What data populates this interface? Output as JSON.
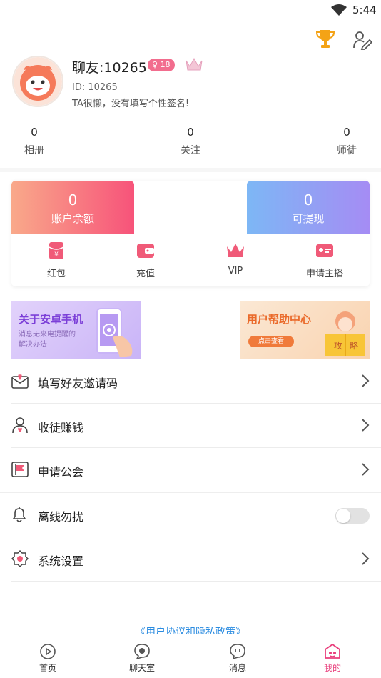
{
  "status_bar": {
    "time": "5:44"
  },
  "profile": {
    "username": "聊友:10265",
    "level": "18",
    "user_id": "ID: 10265",
    "signature": "TA很懒，没有填写个性签名!"
  },
  "stats": [
    {
      "count": "0",
      "label": "相册"
    },
    {
      "count": "0",
      "label": "关注"
    },
    {
      "count": "0",
      "label": "师徒"
    }
  ],
  "wallet": {
    "balance_value": "0",
    "balance_label": "账户余额",
    "withdraw_value": "0",
    "withdraw_label": "可提现",
    "actions": [
      {
        "label": "红包",
        "icon": "red-packet-icon"
      },
      {
        "label": "充值",
        "icon": "wallet-icon"
      },
      {
        "label": "VIP",
        "icon": "crown-icon"
      },
      {
        "label": "申请主播",
        "icon": "anchor-card-icon"
      }
    ]
  },
  "banners": {
    "left_title": "关于安卓手机",
    "left_sub1": "消息无来电提醒的",
    "left_sub2": "解决办法",
    "right_title": "用户帮助中心",
    "right_button": "点击查看",
    "right_book1": "攻",
    "right_book2": "略"
  },
  "menu": [
    {
      "label": "填写好友邀请码",
      "icon": "invite-envelope-icon"
    },
    {
      "label": "收徒赚钱",
      "icon": "apprentice-icon"
    },
    {
      "label": "申请公会",
      "icon": "guild-flag-icon"
    },
    {
      "label": "离线勿扰",
      "icon": "bell-icon",
      "toggle": false
    },
    {
      "label": "系统设置",
      "icon": "settings-icon"
    }
  ],
  "policy_link": "《用户协议和隐私政策》",
  "tabs": [
    {
      "label": "首页",
      "icon": "home-play-icon"
    },
    {
      "label": "聊天室",
      "icon": "chatroom-icon"
    },
    {
      "label": "消息",
      "icon": "message-icon"
    },
    {
      "label": "我的",
      "icon": "me-icon",
      "active": true
    }
  ],
  "colors": {
    "accent_pink": "#e93f7c",
    "balance_gradient": [
      "#f9a98a",
      "#f7537a"
    ],
    "withdraw_gradient": [
      "#7db7f5",
      "#a58cf4"
    ],
    "link_blue": "#2a8be0"
  }
}
